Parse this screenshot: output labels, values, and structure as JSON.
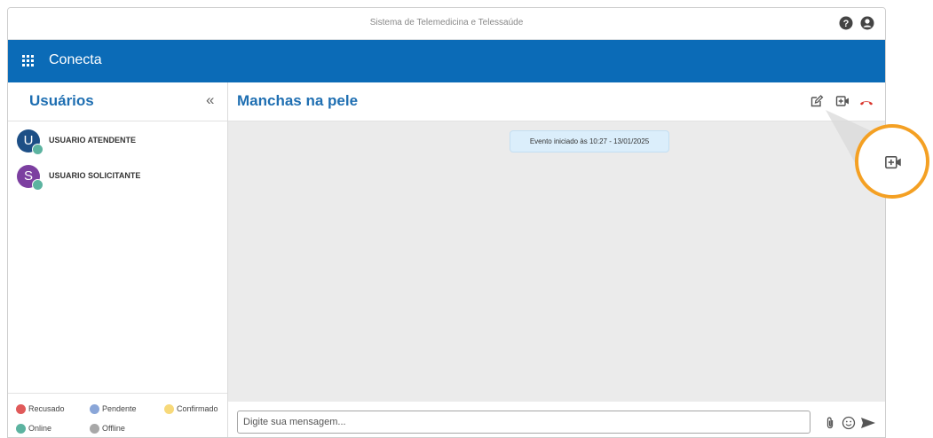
{
  "window": {
    "title": "Sistema de Telemedicina e Telessaúde"
  },
  "appbar": {
    "app_name": "Conecta"
  },
  "sidebar": {
    "title": "Usuários",
    "collapse_glyph": "«",
    "users": [
      {
        "initial": "U",
        "name": "USUARIO ATENDENTE",
        "color": "#1d4f86",
        "status": "Online"
      },
      {
        "initial": "S",
        "name": "USUARIO SOLICITANTE",
        "color": "#7c3fa0",
        "status": "Online"
      }
    ],
    "legend": [
      {
        "label": "Recusado",
        "color": "#e05a5a"
      },
      {
        "label": "Pendente",
        "color": "#8aa6d8"
      },
      {
        "label": "Confirmado",
        "color": "#f7d97a"
      },
      {
        "label": "Online",
        "color": "#5cb3a0"
      },
      {
        "label": "Offline",
        "color": "#a8a8a8"
      }
    ]
  },
  "chat": {
    "title": "Manchas na pele",
    "event_text": "Evento iniciado às 10:27 - 13/01/2025",
    "input_placeholder": "Digite sua mensagem..."
  },
  "colors": {
    "brand": "#0b6bb7",
    "heading": "#1f6fb2",
    "hangup": "#d9342b",
    "highlight": "#f4a023"
  },
  "icons": [
    "help-icon",
    "account-icon",
    "apps-grid-icon",
    "edit-icon",
    "add-video-icon",
    "hang-up-icon",
    "attach-icon",
    "emoji-icon",
    "send-icon"
  ]
}
